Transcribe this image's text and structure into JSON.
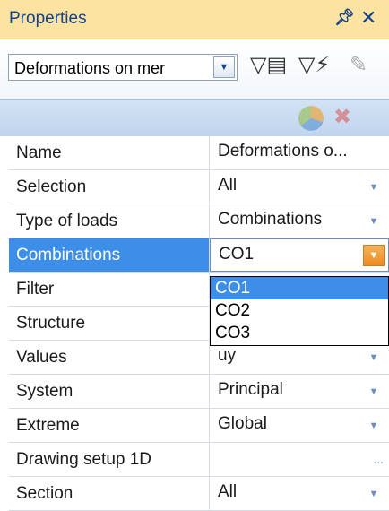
{
  "panel": {
    "title": "Properties",
    "pin_icon": "pin-icon",
    "close_icon": "close-icon"
  },
  "toolbar": {
    "combo_value": "Deformations on mer",
    "icons": [
      "filter-table-icon",
      "filter-funnel-icon",
      "pencil-icon",
      "pie-chart-icon",
      "delete-icon"
    ]
  },
  "properties": [
    {
      "label": "Name",
      "value": "Deformations o...",
      "control": "none"
    },
    {
      "label": "Selection",
      "value": "All",
      "control": "dropdown"
    },
    {
      "label": "Type of loads",
      "value": "Combinations",
      "control": "dropdown"
    },
    {
      "label": "Combinations",
      "value": "CO1",
      "control": "dropdown-active",
      "selected": true
    },
    {
      "label": "Filter",
      "value": "",
      "control": "dropdown"
    },
    {
      "label": "Structure",
      "value": "",
      "control": "dropdown"
    },
    {
      "label": "Values",
      "value": "uy",
      "control": "dropdown"
    },
    {
      "label": "System",
      "value": "Principal",
      "control": "dropdown"
    },
    {
      "label": "Extreme",
      "value": "Global",
      "control": "dropdown"
    },
    {
      "label": "Drawing setup 1D",
      "value": "",
      "control": "ellipsis"
    },
    {
      "label": "Section",
      "value": "All",
      "control": "dropdown"
    }
  ],
  "dropdown": {
    "options": [
      "CO1",
      "CO2",
      "CO3"
    ],
    "selected": "CO1",
    "ellipsis": "..."
  },
  "colors": {
    "accent": "#3d8ee8",
    "header": "#fde3a1",
    "active_button": "#ec8a22"
  }
}
